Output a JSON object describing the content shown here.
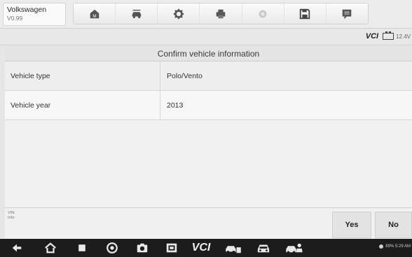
{
  "header": {
    "title": "Volkswagen",
    "version": "V0.99",
    "toolbar": [
      {
        "icon": "home-icon"
      },
      {
        "icon": "vehicle-swap-icon"
      },
      {
        "icon": "settings-gear-icon"
      },
      {
        "icon": "print-icon"
      },
      {
        "icon": "help-icon"
      },
      {
        "icon": "save-icon"
      },
      {
        "icon": "data-logging-icon"
      }
    ]
  },
  "status": {
    "vci_label": "VCI",
    "voltage": "12.4V"
  },
  "panel": {
    "title": "Confirm vehicle information",
    "rows": [
      {
        "label": "Vehicle type",
        "value": "Polo/Vento"
      },
      {
        "label": "Vehicle year",
        "value": "2013"
      }
    ]
  },
  "info": {
    "vin_label": "VIN:",
    "info_label": "Info:"
  },
  "buttons": {
    "yes": "Yes",
    "no": "No"
  },
  "system": {
    "nav_vci": "VCI",
    "status_text": "89% 5:29 AM"
  },
  "colors": {
    "nav_bg": "#1c1c1c",
    "toolbar_icon": "#555555",
    "help_icon_disabled": "#c8c8c8"
  }
}
